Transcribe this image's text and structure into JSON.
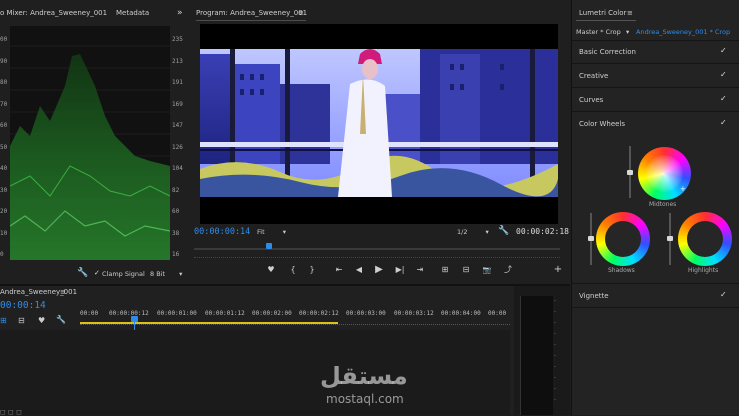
{
  "scopes": {
    "tab_left": "o Mixer: Andrea_Sweeney_001",
    "tab_metadata": "Metadata",
    "more": "»",
    "left_scale": [
      "00",
      "90",
      "80",
      "70",
      "60",
      "50",
      "40",
      "30",
      "20",
      "10",
      "0"
    ],
    "right_scale": [
      "235",
      "213",
      "191",
      "169",
      "147",
      "126",
      "104",
      "82",
      "60",
      "38",
      "16"
    ],
    "clamp_label": "Clamp Signal",
    "bit_depth": "8 Bit"
  },
  "program": {
    "title": "Program: Andrea_Sweeney_001",
    "menu_icon": "≡",
    "timecode_current": "00:00:00:14",
    "fit": "Fit",
    "resolution": "1/2",
    "timecode_duration": "00:00:02:18",
    "buttons": [
      "♥",
      "{",
      "}",
      "⇤",
      "◀",
      "▶",
      "▶|",
      "⇥",
      "⊞",
      "⊟",
      "📷",
      "⤴",
      "+"
    ]
  },
  "timeline": {
    "tab": "Andrea_Sweeney_001",
    "timecode": "00:00:14",
    "ruler": [
      "00:00",
      "00:00:00:12",
      "00:00:01:00",
      "00:00:01:12",
      "00:00:02:00",
      "00:00:02:12",
      "00:00:03:00",
      "00:00:03:12",
      "00:00:04:00",
      "00:00"
    ]
  },
  "lumetri": {
    "title": "Lumetri Color",
    "master": "Master * Crop",
    "clip": "Andrea_Sweeney_001 * Crop",
    "sections": [
      "Basic Correction",
      "Creative",
      "Curves",
      "Color Wheels"
    ],
    "check": "✓",
    "midtones": "Midtones",
    "shadows": "Shadows",
    "highlights": "Highlights",
    "vignette": "Vignette"
  },
  "watermark": {
    "arabic": "مستقل",
    "latin": "mostaql.com"
  },
  "colors": {
    "accent": "#2d8ceb",
    "panel": "#232323",
    "scope_green": "#2fbf3a"
  }
}
